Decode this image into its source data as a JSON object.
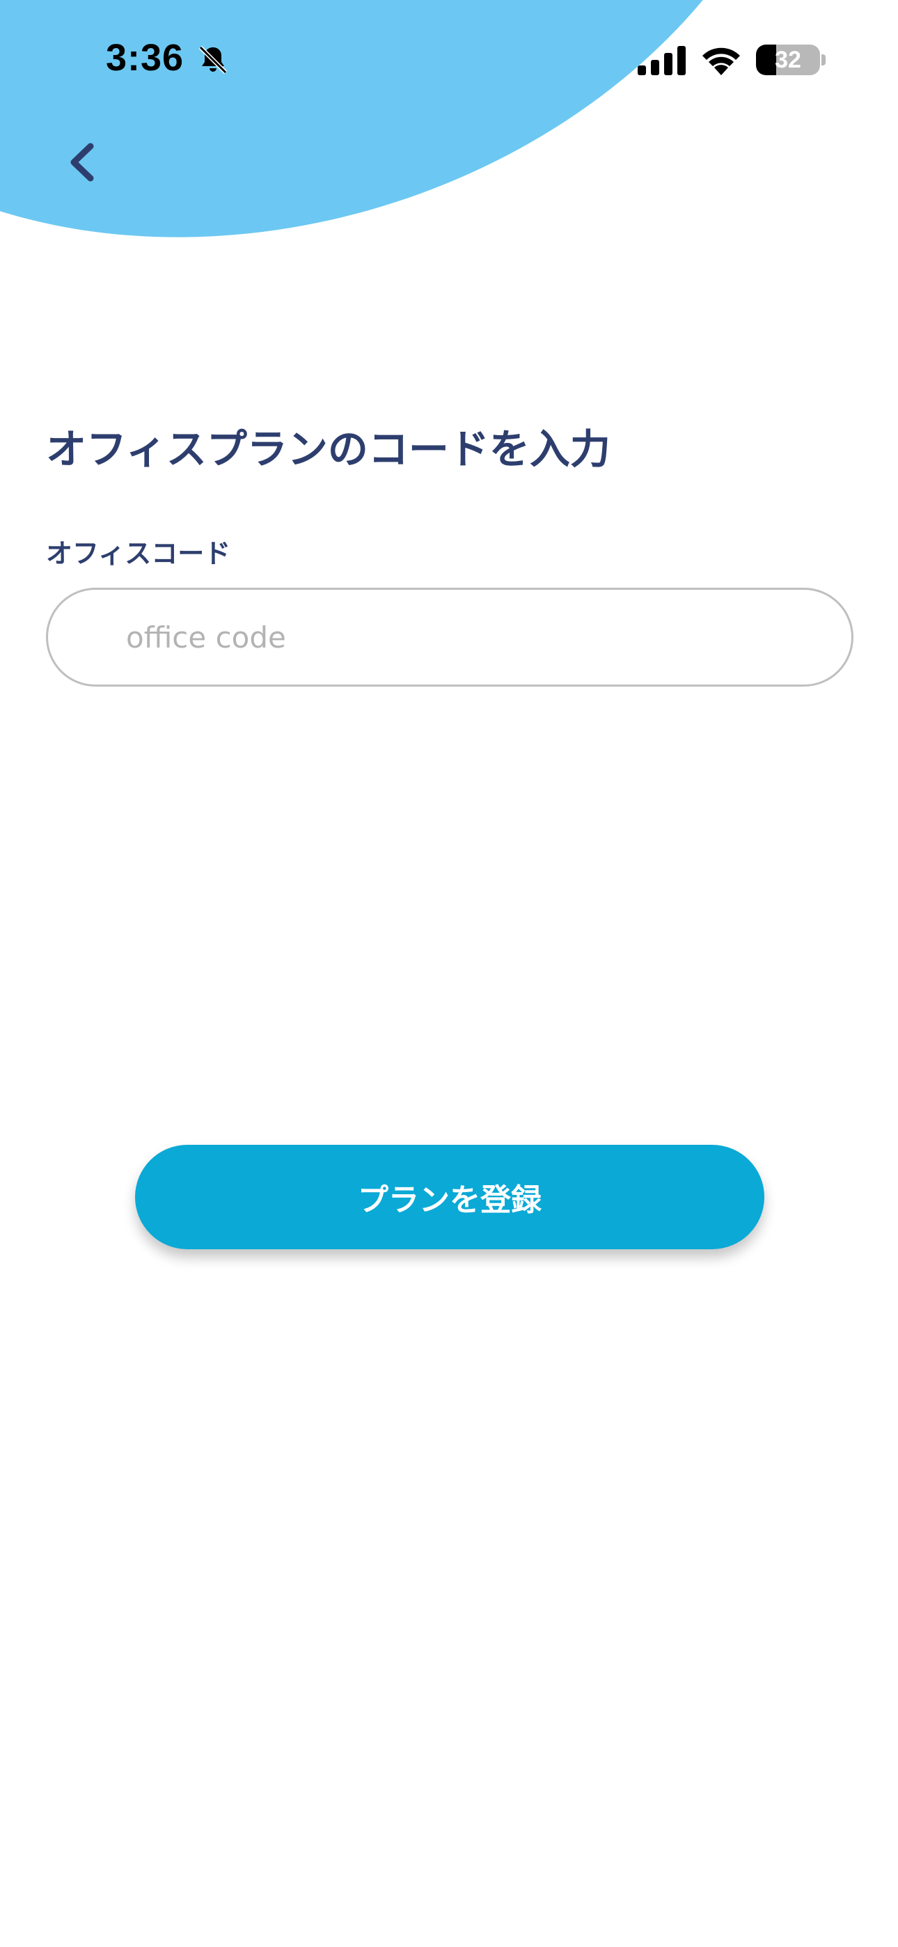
{
  "status_bar": {
    "time": "3:36",
    "battery_level": "32",
    "battery_fraction": 0.32
  },
  "icons": {
    "bell": "bell-slash-icon",
    "signal": "cellular-signal-icon",
    "wifi": "wifi-icon",
    "battery": "battery-icon",
    "back": "chevron-left-icon"
  },
  "header": {
    "title": "オフィスプランのコードを入力"
  },
  "form": {
    "office_code": {
      "label": "オフィスコード",
      "placeholder": "office code",
      "value": ""
    },
    "submit_label": "プランを登録"
  },
  "colors": {
    "accent_blob": "#6cc8f2",
    "title_text": "#2d3e6e",
    "button": "#0aa9d6"
  }
}
